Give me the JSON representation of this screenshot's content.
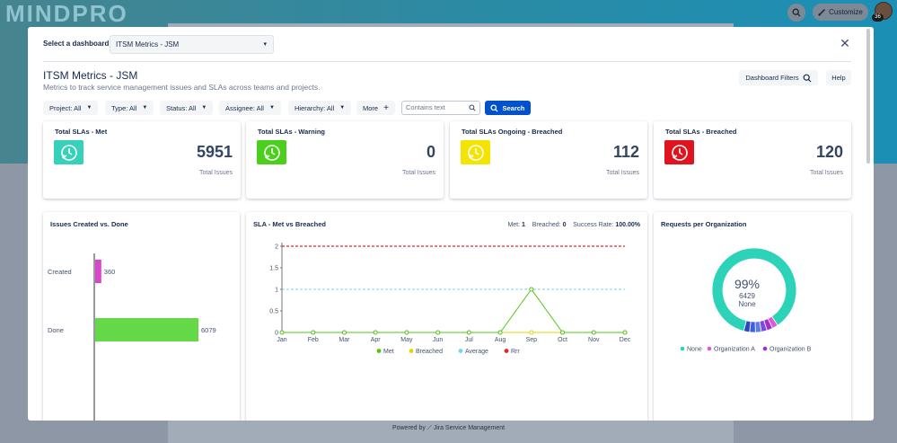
{
  "background": {
    "logo": "MINDPRO",
    "customize_label": "Customize",
    "avatar_badge": "36",
    "footer": "Powered by ⟋ Jira Service Management"
  },
  "dialog": {
    "select_label": "Select a dashboard:",
    "selected_dashboard": "ITSM Metrics - JSM",
    "title": "ITSM Metrics - JSM",
    "subtitle": "Metrics to track service management issues and SLAs across teams and projects.",
    "dashboard_filters_label": "Dashboard Filters",
    "help_label": "Help"
  },
  "filters": {
    "project": "Project: All",
    "type": "Type: All",
    "status": "Status: All",
    "assignee": "Assignee: All",
    "hierarchy": "Hierarchy: All",
    "more": "More",
    "search_placeholder": "Contains text",
    "search_button": "Search"
  },
  "kpis": [
    {
      "title": "Total SLAs - Met",
      "value": "5951",
      "sub": "Total Issues",
      "color": "#36d1b8"
    },
    {
      "title": "Total SLAs - Warning",
      "value": "0",
      "sub": "Total Issues",
      "color": "#4bce1c"
    },
    {
      "title": "Total SLAs Ongoing - Breached",
      "value": "112",
      "sub": "Total Issues",
      "color": "#f5e400"
    },
    {
      "title": "Total SLAs - Breached",
      "value": "120",
      "sub": "Total Issues",
      "color": "#e0141e"
    }
  ],
  "chart_data": [
    {
      "type": "bar",
      "title": "Issues Created vs. Done",
      "orientation": "horizontal",
      "categories": [
        "Created",
        "Done"
      ],
      "values": [
        360,
        6079
      ],
      "colors": [
        "#d946c9",
        "#64d846"
      ]
    },
    {
      "type": "line",
      "title": "SLA - Met vs Breached",
      "stats": {
        "met_label": "Met:",
        "met": "1",
        "breached_label": "Breached:",
        "breached": "0",
        "rate_label": "Success Rate:",
        "rate": "100.00%"
      },
      "x": [
        "Jan",
        "Feb",
        "Mar",
        "Apr",
        "May",
        "Jun",
        "Jul",
        "Aug",
        "Sep",
        "Oct",
        "Nov",
        "Dec"
      ],
      "ylim": [
        0,
        2
      ],
      "yticks": [
        "0",
        "0.5",
        "1",
        "1.5",
        "2"
      ],
      "series": [
        {
          "name": "Met",
          "color": "#52c41a",
          "values": [
            0,
            0,
            0,
            0,
            0,
            0,
            0,
            0,
            1,
            0,
            0,
            0
          ]
        },
        {
          "name": "Breached",
          "color": "#e5d400",
          "values": [
            0,
            0,
            0,
            0,
            0,
            0,
            0,
            0,
            0,
            0,
            0,
            0
          ]
        },
        {
          "name": "Average",
          "color": "#7ad3ee",
          "values": [
            1,
            1,
            1,
            1,
            1,
            1,
            1,
            1,
            1,
            1,
            1,
            1
          ]
        },
        {
          "name": "Rrr",
          "color": "#e5252a",
          "values": [
            2,
            2,
            2,
            2,
            2,
            2,
            2,
            2,
            2,
            2,
            2,
            2
          ]
        }
      ]
    },
    {
      "type": "pie",
      "title": "Requests per Organization",
      "center_percent": "99%",
      "center_value": "6429",
      "center_label": "None",
      "slices": [
        {
          "name": "None",
          "value": 6429,
          "color": "#2dd3b9"
        },
        {
          "name": "Organization A",
          "value": 16,
          "color": "#dc58d4"
        },
        {
          "name": "Organization B",
          "value": 16,
          "color": "#a02fd0"
        },
        {
          "name": "",
          "value": 15,
          "color": "#7f48e0"
        },
        {
          "name": "",
          "value": 14,
          "color": "#5b7de8"
        },
        {
          "name": "",
          "value": 14,
          "color": "#3f5de0"
        },
        {
          "name": "",
          "value": 12,
          "color": "#2c45c4"
        }
      ]
    }
  ]
}
